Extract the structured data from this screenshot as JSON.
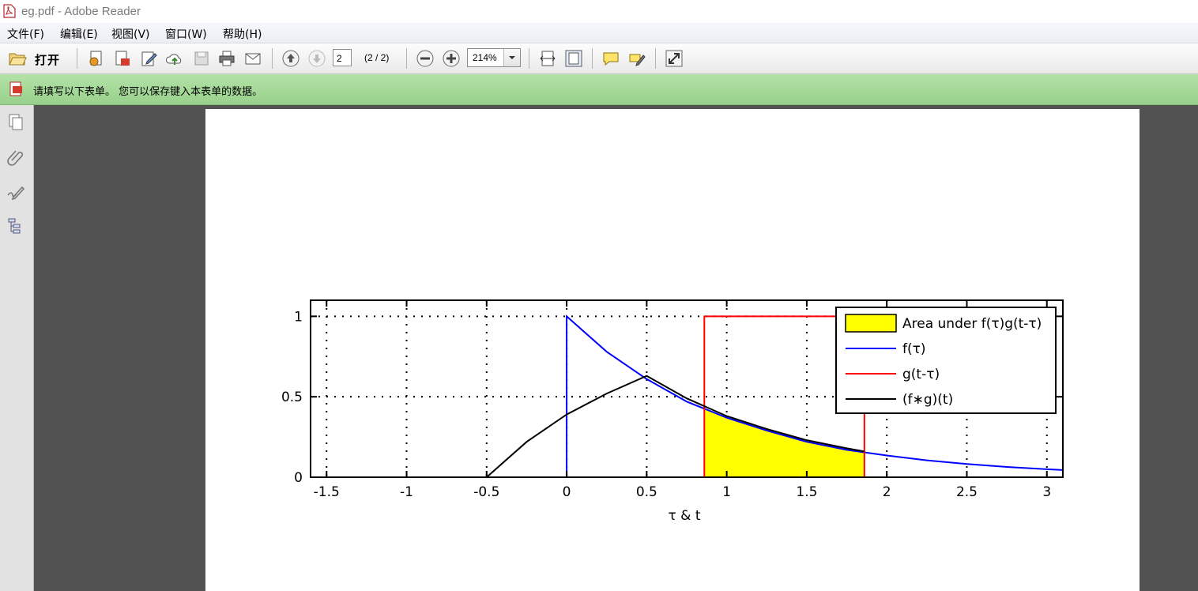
{
  "window": {
    "title": "eg.pdf - Adobe Reader"
  },
  "menu": {
    "items": [
      "文件(F)",
      "编辑(E)",
      "视图(V)",
      "窗口(W)",
      "帮助(H)"
    ]
  },
  "toolbar": {
    "open_label": "打开",
    "page_number": "2",
    "page_count": "(2 / 2)",
    "zoom": "214%"
  },
  "formbar": {
    "message": "请填写以下表单。 您可以保存键入本表单的数据。"
  },
  "colors": {
    "accent_green": "#98d18c",
    "doc_background": "#525252",
    "series_f": "#0000ff",
    "series_g": "#ff0000",
    "series_conv": "#000000",
    "area_fill": "#ffff00"
  },
  "icons": {
    "toolbar": [
      "open-folder-icon",
      "create-pdf-icon",
      "combine-icon",
      "edit-form-icon",
      "upload-icon",
      "save-icon",
      "print-icon",
      "email-icon",
      "prev-page-icon",
      "next-page-icon",
      "zoom-out-icon",
      "zoom-in-icon",
      "fit-width-icon",
      "fit-page-icon",
      "comment-icon",
      "highlight-icon",
      "fullscreen-icon"
    ],
    "leftpane": [
      "pages-icon",
      "attachments-icon",
      "signatures-icon",
      "layers-icon"
    ]
  },
  "chart_data": {
    "type": "line",
    "xlabel": "τ & t",
    "ylabel": "",
    "xlim": [
      -1.6,
      3.1
    ],
    "ylim": [
      0,
      1.1
    ],
    "x_ticks": [
      -1.5,
      -1,
      -0.5,
      0,
      0.5,
      1,
      1.5,
      2,
      2.5,
      3
    ],
    "x_tick_labels": [
      "-1.5",
      "-1",
      "-0.5",
      "0",
      "0.5",
      "1",
      "1.5",
      "2",
      "2.5",
      "3"
    ],
    "y_ticks": [
      0,
      0.5,
      1
    ],
    "y_tick_labels": [
      "0",
      "0.5",
      "1"
    ],
    "grid": true,
    "legend_position": "top-right",
    "legend": [
      "Area under f(τ)g(t-τ)",
      "f(τ)",
      "g(t-τ)",
      "(f∗g)(t)"
    ],
    "series": [
      {
        "name": "f(τ)",
        "x": [
          0,
          0,
          0.25,
          0.5,
          0.75,
          1,
          1.25,
          1.5,
          1.75,
          2,
          2.25,
          2.5,
          2.75,
          3,
          3.1
        ],
        "y": [
          0,
          1,
          0.78,
          0.61,
          0.47,
          0.37,
          0.29,
          0.22,
          0.17,
          0.135,
          0.105,
          0.082,
          0.064,
          0.05,
          0.045
        ]
      },
      {
        "name": "g(t-τ)",
        "x": [
          0.86,
          0.86,
          1.86,
          1.86
        ],
        "y": [
          0,
          1,
          1,
          0
        ]
      },
      {
        "name": "(f∗g)(t)",
        "x": [
          -0.5,
          -0.25,
          0,
          0.25,
          0.5,
          0.75,
          1,
          1.25,
          1.5,
          1.75,
          1.86
        ],
        "y": [
          0,
          0.22,
          0.39,
          0.52,
          0.63,
          0.49,
          0.38,
          0.3,
          0.23,
          0.18,
          0.16
        ]
      },
      {
        "name": "Area under f(τ)g(t-τ)",
        "x": [
          0.86,
          1,
          1.25,
          1.5,
          1.75,
          1.86
        ],
        "y": [
          0.43,
          0.37,
          0.29,
          0.22,
          0.17,
          0.16
        ]
      }
    ]
  }
}
